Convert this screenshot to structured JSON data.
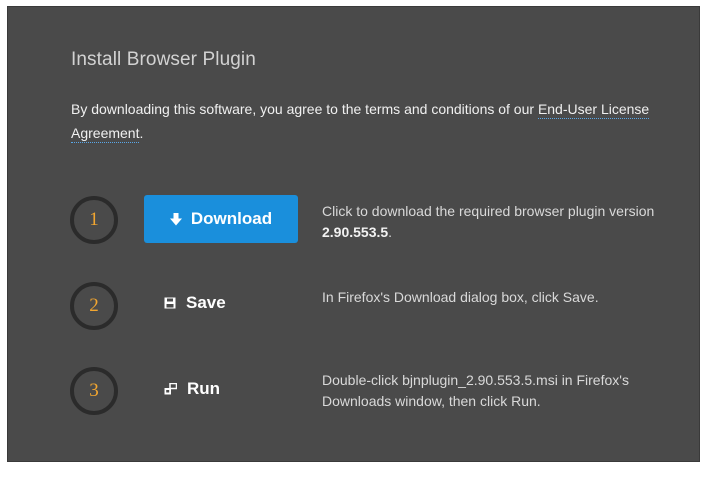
{
  "panel": {
    "title": "Install Browser Plugin",
    "intro_text": "By downloading this software, you agree to the terms and conditions of our ",
    "license_link": "End-User License Agreement",
    "intro_suffix": "."
  },
  "steps": [
    {
      "number": "1",
      "action_label": "Download",
      "action_icon": "download-arrow-icon",
      "description_prefix": "Click to download the required browser plugin version ",
      "description_bold": "2.90.553.5",
      "description_suffix": "."
    },
    {
      "number": "2",
      "action_label": "Save",
      "action_icon": "floppy-disk-icon",
      "description": "In Firefox's Download dialog box, click Save."
    },
    {
      "number": "3",
      "action_label": "Run",
      "action_icon": "run-program-icon",
      "description": "Double-click bjnplugin_2.90.553.5.msi in Firefox's Downloads window, then click Run."
    }
  ],
  "colors": {
    "panel_bg": "#4a4a4a",
    "accent_blue": "#1a8fdc",
    "step_number": "#f2a630"
  }
}
